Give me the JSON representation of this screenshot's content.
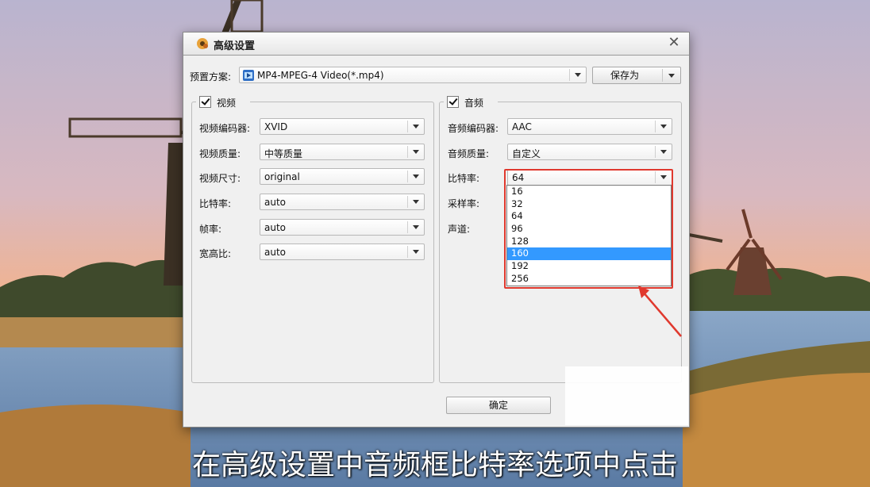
{
  "dialog": {
    "title": "高级设置",
    "close_glyph": "✕",
    "preset_label": "预置方案:",
    "preset_value": "MP4-MPEG-4 Video(*.mp4)",
    "save_as_label": "保存为",
    "ok_label": "确定"
  },
  "video": {
    "group_label": "视频",
    "enabled": true,
    "fields": [
      {
        "label": "视频编码器:",
        "value": "XVID"
      },
      {
        "label": "视频质量:",
        "value": "中等质量"
      },
      {
        "label": "视频尺寸:",
        "value": "original"
      },
      {
        "label": "比特率:",
        "value": "auto"
      },
      {
        "label": "帧率:",
        "value": "auto"
      },
      {
        "label": "宽高比:",
        "value": "auto"
      }
    ]
  },
  "audio": {
    "group_label": "音频",
    "enabled": true,
    "encoder_label": "音频编码器:",
    "encoder_value": "AAC",
    "quality_label": "音频质量:",
    "quality_value": "自定义",
    "bitrate_label": "比特率:",
    "bitrate_value": "64",
    "samplerate_label": "采样率:",
    "channel_label": "声道:",
    "bitrate_options": [
      "16",
      "32",
      "64",
      "96",
      "128",
      "160",
      "192",
      "256"
    ],
    "highlighted_option": "160"
  },
  "caption": "在高级设置中音频框比特率选项中点击",
  "colors": {
    "highlight_box": "#e0392e",
    "selection": "#3399ff"
  }
}
